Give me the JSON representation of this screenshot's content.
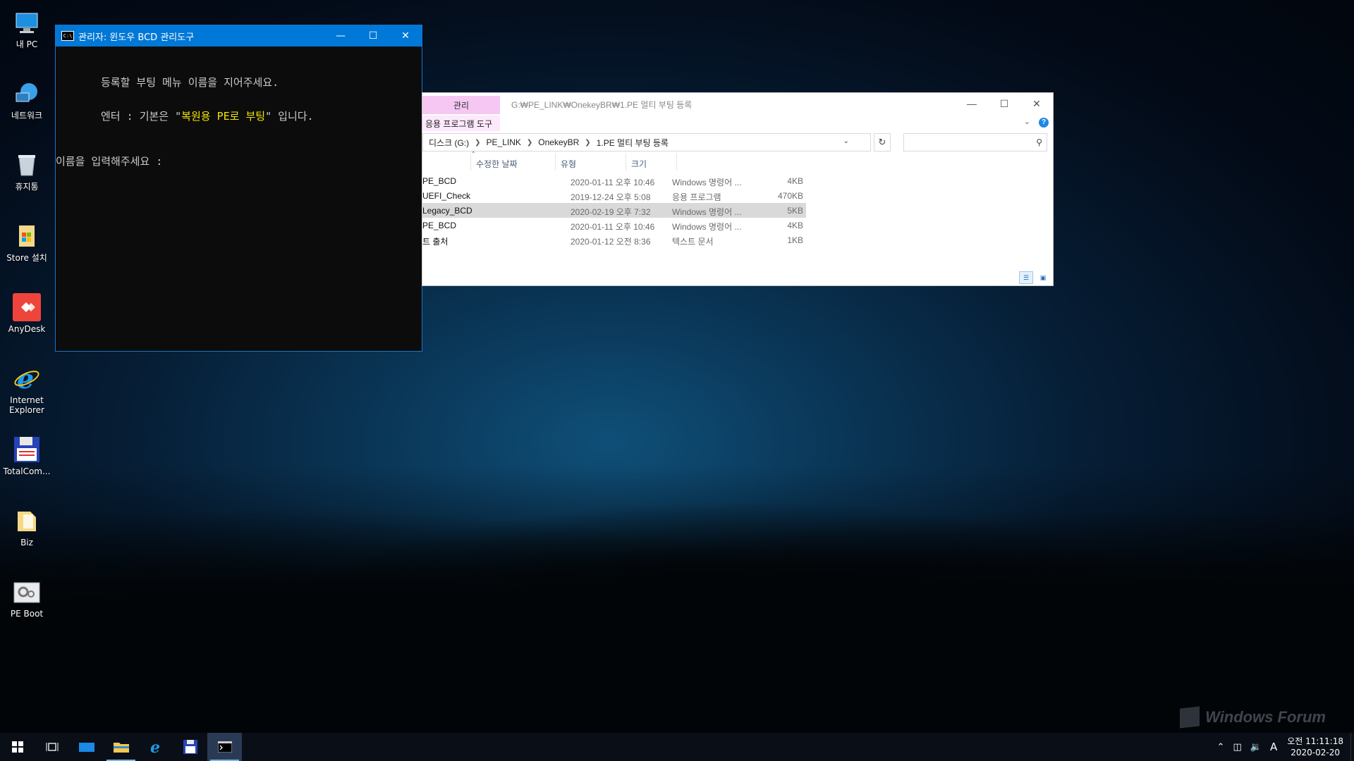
{
  "desktop": {
    "icons": [
      {
        "label": "내 PC",
        "icon": "computer-icon"
      },
      {
        "label": "네트워크",
        "icon": "network-icon"
      },
      {
        "label": "휴지통",
        "icon": "recycle-bin-icon"
      },
      {
        "label": "Store 설치",
        "icon": "store-icon"
      },
      {
        "label": "AnyDesk",
        "icon": "anydesk-icon"
      },
      {
        "label": "Internet Explorer",
        "icon": "internet-explorer-icon"
      },
      {
        "label": "TotalCom...",
        "icon": "floppy-disk-icon"
      },
      {
        "label": "Biz",
        "icon": "folder-icon"
      },
      {
        "label": "PE Boot",
        "icon": "gear-folder-icon"
      }
    ]
  },
  "console": {
    "title": "관리자:  윈도우 BCD 관리도구",
    "line1": "등록할 부팅 메뉴 이름을 지어주세요.",
    "line2_prefix": "엔터 : 기본은 \"",
    "line2_highlight": "복원용 PE로 부팅",
    "line2_suffix": "\" 입니다.",
    "prompt": "이름을 입력해주세요 :"
  },
  "explorer": {
    "manage_tab": "관리",
    "app_tools": "응용 프로그램 도구",
    "title_path": "G:₩PE_LINK₩OnekeyBR₩1.PE 멀티 부팅 등록",
    "breadcrumb": [
      "디스크 (G:)",
      "PE_LINK",
      "OnekeyBR",
      "1.PE 멀티 부팅 등록"
    ],
    "columns": {
      "date": "수정한 날짜",
      "type": "유형",
      "size": "크기"
    },
    "files": [
      {
        "name": "PE_BCD",
        "date": "2020-01-11 오후 10:46",
        "type": "Windows 명령어 ...",
        "size": "4KB",
        "selected": false
      },
      {
        "name": "UEFI_Check",
        "date": "2019-12-24 오후 5:08",
        "type": "응용 프로그램",
        "size": "470KB",
        "selected": false
      },
      {
        "name": "Legacy_BCD",
        "date": "2020-02-19 오후 7:32",
        "type": "Windows 명령어 ...",
        "size": "5KB",
        "selected": true
      },
      {
        "name": "PE_BCD",
        "date": "2020-01-11 오후 10:46",
        "type": "Windows 명령어 ...",
        "size": "4KB",
        "selected": false
      },
      {
        "name": "트 출처",
        "date": "2020-01-12 오전 8:36",
        "type": "텍스트 문서",
        "size": "1KB",
        "selected": false
      }
    ]
  },
  "taskbar": {
    "time": "오전 11:11:18",
    "date": "2020-02-20",
    "ime": "A"
  },
  "watermark": "Windows Forum"
}
